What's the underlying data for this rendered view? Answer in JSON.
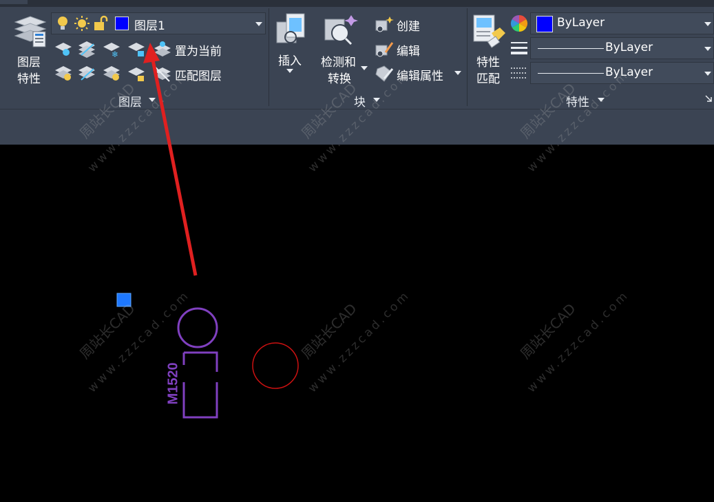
{
  "ribbon": {
    "layers_panel": {
      "layer_properties_label_line1": "图层",
      "layer_properties_label_line2": "特性",
      "current_layer": "图层1",
      "set_current_label": "置为当前",
      "match_layer_label": "匹配图层",
      "panel_title": "图层"
    },
    "block_panel": {
      "insert_label": "插入",
      "detect_convert_line1": "检测和",
      "detect_convert_line2": "转换",
      "create_label": "创建",
      "edit_label": "编辑",
      "edit_attributes_label": "编辑属性",
      "panel_title": "块"
    },
    "properties_panel": {
      "match_props_line1": "特性",
      "match_props_line2": "匹配",
      "color_value": "ByLayer",
      "lineweight_value": "ByLayer",
      "linetype_value": "ByLayer",
      "panel_title": "特性"
    }
  },
  "drawing": {
    "door_tag": "M1520"
  },
  "watermark": {
    "brand": "周站长CAD",
    "site": "www.zzzcad.com"
  },
  "colors": {
    "ribbon_bg": "#3b4453",
    "canvas_bg": "#000000",
    "layer_color": "#0000ff",
    "door_symbol": "#8040c0",
    "circle": "#cc1111",
    "arrow": "#e02020",
    "grip": "#1e78ff"
  }
}
